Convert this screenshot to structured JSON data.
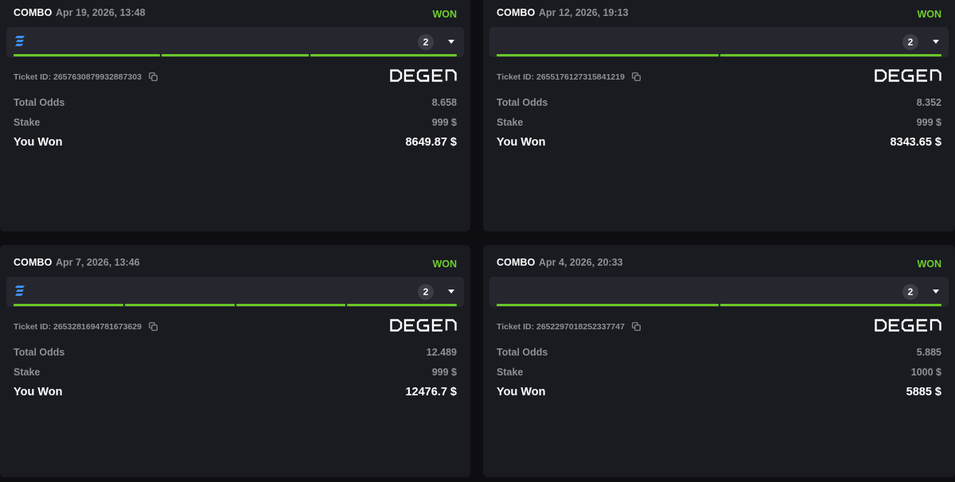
{
  "labels": {
    "ticket_prefix": "Ticket ID:",
    "total_odds": "Total Odds",
    "stake": "Stake",
    "you_won": "You Won"
  },
  "colors": {
    "won": "#6fce2f",
    "progress": "#69c728",
    "sport_icon": "#3a8ff0"
  },
  "bets": [
    {
      "type": "COMBO",
      "date": "Apr 19, 2026, 13:48",
      "status": "WON",
      "show_sport_icon": true,
      "sport_icon": "sport-icon",
      "legs_count": "2",
      "segments": 3,
      "ticket_id": "2657630879932887303",
      "brand": "DEGEN",
      "total_odds": "8.658",
      "stake": "999 $",
      "won": "8649.87 $"
    },
    {
      "type": "COMBO",
      "date": "Apr 12, 2026, 19:13",
      "status": "WON",
      "show_sport_icon": false,
      "sport_icon": "sport-icon",
      "legs_count": "2",
      "segments": 2,
      "ticket_id": "2655176127315841219",
      "brand": "DEGEN",
      "total_odds": "8.352",
      "stake": "999 $",
      "won": "8343.65 $"
    },
    {
      "type": "COMBO",
      "date": "Apr 7, 2026, 13:46",
      "status": "WON",
      "show_sport_icon": true,
      "sport_icon": "sport-icon",
      "legs_count": "2",
      "segments": 4,
      "ticket_id": "2653281694781673629",
      "brand": "DEGEN",
      "total_odds": "12.489",
      "stake": "999 $",
      "won": "12476.7 $"
    },
    {
      "type": "COMBO",
      "date": "Apr 4, 2026, 20:33",
      "status": "WON",
      "show_sport_icon": false,
      "sport_icon": "sport-icon",
      "legs_count": "2",
      "segments": 2,
      "ticket_id": "2652297018252337747",
      "brand": "DEGEN",
      "total_odds": "5.885",
      "stake": "1000 $",
      "won": "5885 $"
    }
  ]
}
